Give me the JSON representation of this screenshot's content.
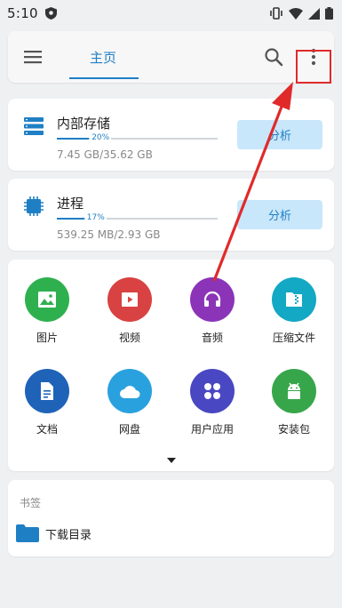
{
  "status_bar": {
    "time": "5:10"
  },
  "appbar": {
    "tab_home": "主页"
  },
  "storage": {
    "title": "内部存储",
    "percent_label": "20%",
    "percent": 0.2,
    "size": "7.45 GB/35.62 GB",
    "analyze_label": "分析"
  },
  "process": {
    "title": "进程",
    "percent_label": "17%",
    "percent": 0.17,
    "size": "539.25 MB/2.93 GB",
    "analyze_label": "分析"
  },
  "categories": [
    {
      "label": "图片",
      "icon": "image-icon",
      "color": "#2fb04f"
    },
    {
      "label": "视频",
      "icon": "video-icon",
      "color": "#d94242"
    },
    {
      "label": "音频",
      "icon": "headphones-icon",
      "color": "#8b34b8"
    },
    {
      "label": "压缩文件",
      "icon": "archive-icon",
      "color": "#13a8c3"
    },
    {
      "label": "文档",
      "icon": "document-icon",
      "color": "#1f63b8"
    },
    {
      "label": "网盘",
      "icon": "cloud-icon",
      "color": "#2aa1df"
    },
    {
      "label": "用户应用",
      "icon": "apps-icon",
      "color": "#4a47c2"
    },
    {
      "label": "安装包",
      "icon": "android-icon",
      "color": "#37a64a"
    }
  ],
  "bookmarks": {
    "title": "书签",
    "items": [
      {
        "label": "下载目录",
        "icon": "folder-icon"
      }
    ]
  },
  "colors": {
    "accent": "#1f7fc5",
    "highlight": "#e02a2a"
  }
}
